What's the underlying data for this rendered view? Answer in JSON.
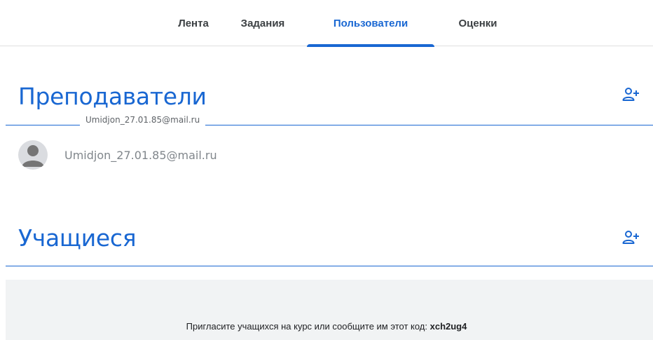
{
  "tabs": [
    {
      "label": "Лента",
      "active": false
    },
    {
      "label": "Задания",
      "active": false
    },
    {
      "label": "Пользователи",
      "active": true
    },
    {
      "label": "Оценки",
      "active": false
    }
  ],
  "teachers": {
    "title": "Преподаватели",
    "tooltip": "Umidjon_27.01.85@mail.ru",
    "members": [
      {
        "name": "Umidjon_27.01.85@mail.ru"
      }
    ],
    "add_icon": "person-add-icon"
  },
  "students": {
    "title": "Учащиеся",
    "add_icon": "person-add-icon",
    "invite_text": "Пригласите учащихся на курс или сообщите им этот код: ",
    "class_code": "xch2ug4"
  },
  "colors": {
    "accent": "#1967d2",
    "text": "#3c4043",
    "muted": "#80868b",
    "panel": "#f1f3f4"
  }
}
